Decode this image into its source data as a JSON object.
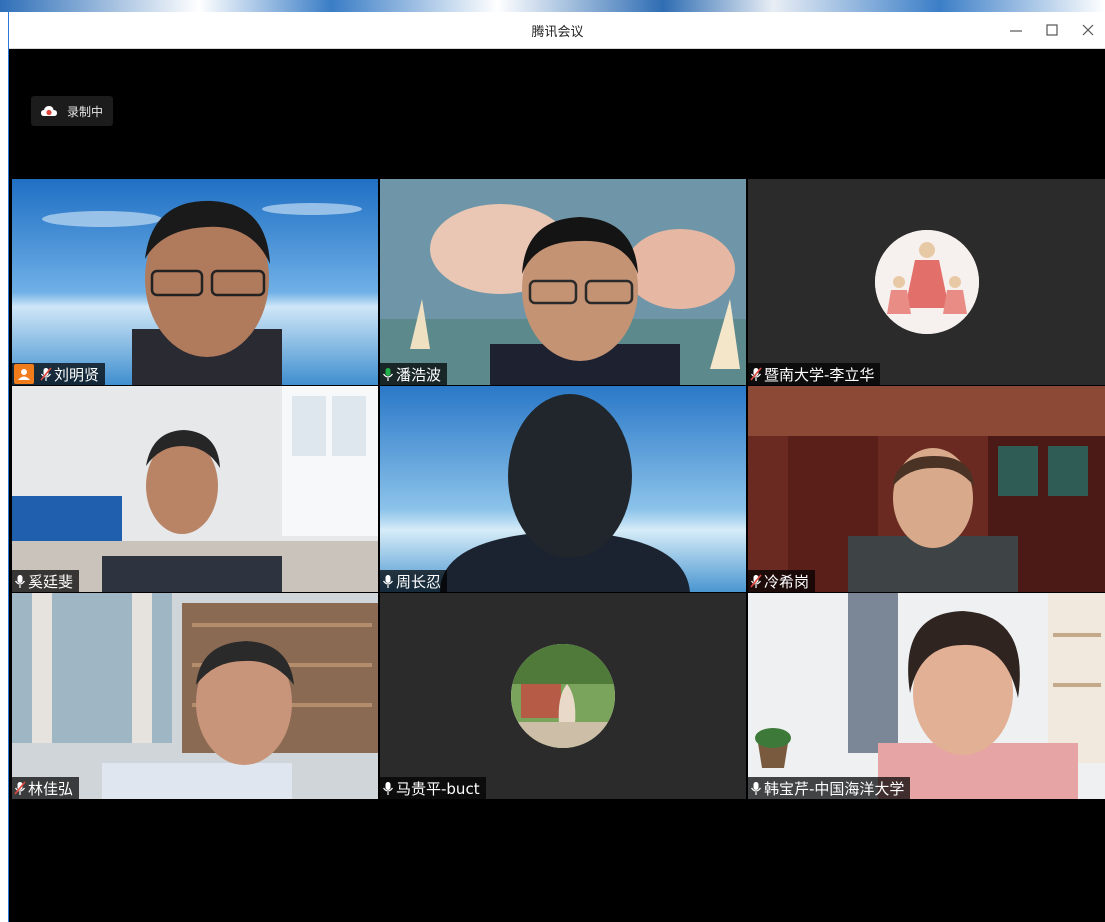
{
  "window": {
    "title": "腾讯会议",
    "controls": {
      "minimize_icon": "minimize-icon",
      "maximize_icon": "maximize-icon",
      "close_icon": "close-icon"
    }
  },
  "recording": {
    "label": "录制中",
    "icon": "cloud-record-icon"
  },
  "participants": [
    {
      "name": "刘明贤",
      "mic": "muted",
      "host": true,
      "video": "on"
    },
    {
      "name": "潘浩波",
      "mic": "speaking",
      "host": false,
      "video": "on",
      "active_speaker": true
    },
    {
      "name": "暨南大学-李立华",
      "mic": "muted",
      "host": false,
      "video": "off"
    },
    {
      "name": "奚廷斐",
      "mic": "on",
      "host": false,
      "video": "on"
    },
    {
      "name": "周长忍",
      "mic": "on",
      "host": false,
      "video": "on"
    },
    {
      "name": "冷希岗",
      "mic": "muted",
      "host": false,
      "video": "on"
    },
    {
      "name": "林佳弘",
      "mic": "muted",
      "host": false,
      "video": "on"
    },
    {
      "name": "马贵平-buct",
      "mic": "on",
      "host": false,
      "video": "off"
    },
    {
      "name": "韩宝芹-中国海洋大学",
      "mic": "on",
      "host": false,
      "video": "on"
    }
  ],
  "colors": {
    "stage_bg": "#000000",
    "tile_off_bg": "#2b2b2b",
    "active_border": "#22b04b",
    "host_badge": "#f07c1c",
    "mic_on": "#ffffff",
    "mic_muted": "#e0463c"
  }
}
